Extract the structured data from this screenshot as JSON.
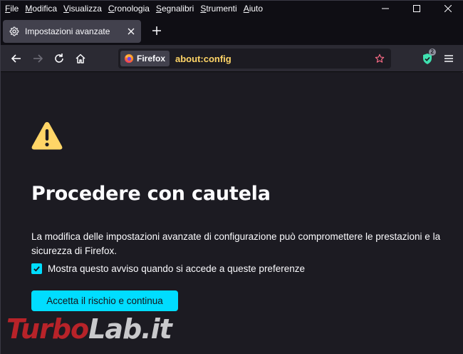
{
  "menubar": {
    "items": [
      {
        "first": "F",
        "rest": "ile"
      },
      {
        "first": "M",
        "rest": "odifica"
      },
      {
        "first": "V",
        "rest": "isualizza"
      },
      {
        "first": "C",
        "rest": "ronologia"
      },
      {
        "first": "S",
        "rest": "egnalibri"
      },
      {
        "first": "S",
        "rest": "trumenti"
      },
      {
        "first": "A",
        "rest": "iuto"
      }
    ]
  },
  "tab": {
    "title": "Impostazioni avanzate",
    "icon": "gear-icon"
  },
  "urlbar": {
    "identity_label": "Firefox",
    "url": "about:config"
  },
  "extension": {
    "badge": "2",
    "icon": "shield-check-icon"
  },
  "page": {
    "title": "Procedere con cautela",
    "description": "La modifica delle impostazioni avanzate di configurazione può compromettere le prestazioni e la sicurezza di Firefox.",
    "checkbox_label": "Mostra questo avviso quando si accede a queste preferenze",
    "checkbox_checked": true,
    "accept_button": "Accetta il rischio e continua"
  },
  "watermark": {
    "part1": "Turbo",
    "part2": "Lab.it"
  },
  "colors": {
    "accent": "#00ddff",
    "url_text": "#ffd567",
    "warning": "#ffd567",
    "background": "#1c1b22",
    "chrome": "#0f0e14",
    "toolbar": "#2b2a33"
  }
}
